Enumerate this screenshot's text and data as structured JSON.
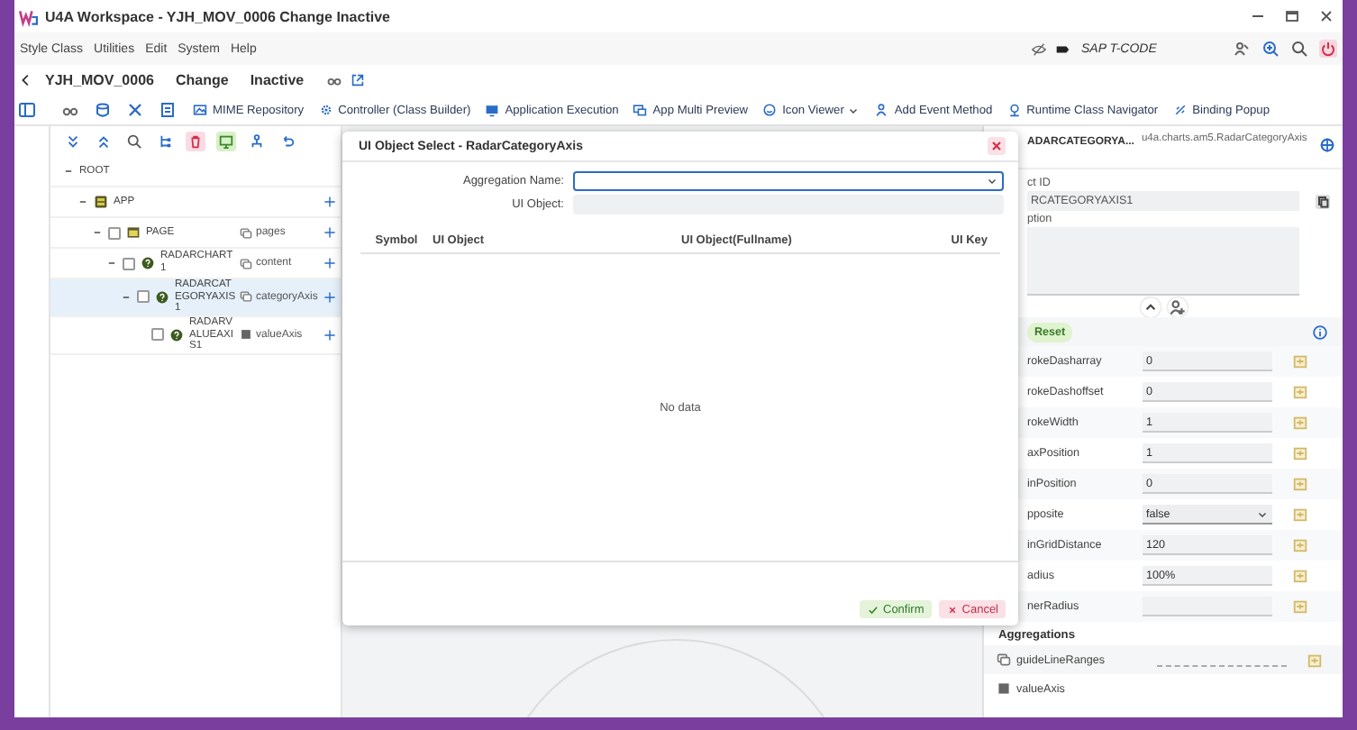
{
  "window": {
    "title": "U4A Workspace - YJH_MOV_0006 Change Inactive"
  },
  "menu": [
    {
      "label": "Style Class"
    },
    {
      "label": "Utilities"
    },
    {
      "label": "Edit"
    },
    {
      "label": "System"
    },
    {
      "label": "Help"
    }
  ],
  "tcode": {
    "placeholder": "SAP T-CODE"
  },
  "header": {
    "app_id": "YJH_MOV_0006",
    "mode": "Change",
    "status": "Inactive"
  },
  "toolbar": [
    {
      "label": "MIME Repository",
      "dropdown": false
    },
    {
      "label": "Controller (Class Builder)",
      "dropdown": false
    },
    {
      "label": "Application Execution",
      "dropdown": false
    },
    {
      "label": "App Multi Preview",
      "dropdown": false
    },
    {
      "label": "Icon Viewer",
      "dropdown": true
    },
    {
      "label": "Add Event Method",
      "dropdown": false
    },
    {
      "label": "Runtime Class Navigator",
      "dropdown": false
    },
    {
      "label": "Binding Popup",
      "dropdown": false
    }
  ],
  "tree": [
    {
      "name": "ROOT",
      "kind": "root",
      "expanded": true,
      "selected": false,
      "children": [
        {
          "name": "APP",
          "kind": "app",
          "expanded": true,
          "selected": false,
          "children": [
            {
              "name": "PAGE",
              "kind": "page",
              "checked": false,
              "aggregation": "pages",
              "multiple": true,
              "expanded": true,
              "selected": false,
              "children": [
                {
                  "name": "RADARCHART1",
                  "kind": "control",
                  "checked": false,
                  "aggregation": "content",
                  "multiple": true,
                  "expanded": true,
                  "selected": false,
                  "children": [
                    {
                      "name": "RADARCATEGORYAXIS1",
                      "kind": "control",
                      "checked": false,
                      "aggregation": "categoryAxis",
                      "multiple": true,
                      "expanded": true,
                      "selected": true,
                      "children": [
                        {
                          "name": "RADARVALUEAXIS1",
                          "kind": "control",
                          "checked": false,
                          "aggregation": "valueAxis",
                          "multiple": false,
                          "selected": false
                        }
                      ]
                    }
                  ]
                }
              ]
            }
          ]
        }
      ]
    }
  ],
  "properties": {
    "title": "ADARCATEGORYA...",
    "class_name": "u4a.charts.am5.RadarCategoryAxis",
    "id_label": "ct ID",
    "id_value": "RCATEGORYAXIS1",
    "description_label": "ption",
    "reset": "Reset",
    "rows": [
      {
        "name": "rokeDasharray",
        "kind": "input",
        "value": "0"
      },
      {
        "name": "rokeDashoffset",
        "kind": "input",
        "value": "0"
      },
      {
        "name": "rokeWidth",
        "kind": "input",
        "value": "1"
      },
      {
        "name": "axPosition",
        "kind": "input",
        "value": "1"
      },
      {
        "name": "inPosition",
        "kind": "input",
        "value": "0"
      },
      {
        "name": "pposite",
        "kind": "select",
        "value": "false"
      },
      {
        "name": "inGridDistance",
        "kind": "input",
        "value": "120"
      },
      {
        "name": "adius",
        "kind": "input",
        "value": "100%"
      },
      {
        "name": "nerRadius",
        "kind": "input"
      }
    ],
    "aggregations_title": "Aggregations",
    "aggregations": [
      {
        "name": "guideLineRanges",
        "kind": "multiple",
        "binding_field": true
      },
      {
        "name": "valueAxis",
        "kind": "single",
        "binding_field": false
      }
    ]
  },
  "dialog": {
    "title": "UI Object Select - RadarCategoryAxis",
    "fields": [
      {
        "label": "Aggregation Name:",
        "kind": "select",
        "focused": true
      },
      {
        "label": "UI Object:",
        "kind": "readonly",
        "focused": false
      }
    ],
    "columns": [
      "Symbol",
      "UI Object",
      "UI Object(Fullname)",
      "UI Key"
    ],
    "empty_text": "No data",
    "buttons": [
      {
        "label": "Confirm",
        "kind": "confirm"
      },
      {
        "label": "Cancel",
        "kind": "cancel"
      }
    ]
  }
}
